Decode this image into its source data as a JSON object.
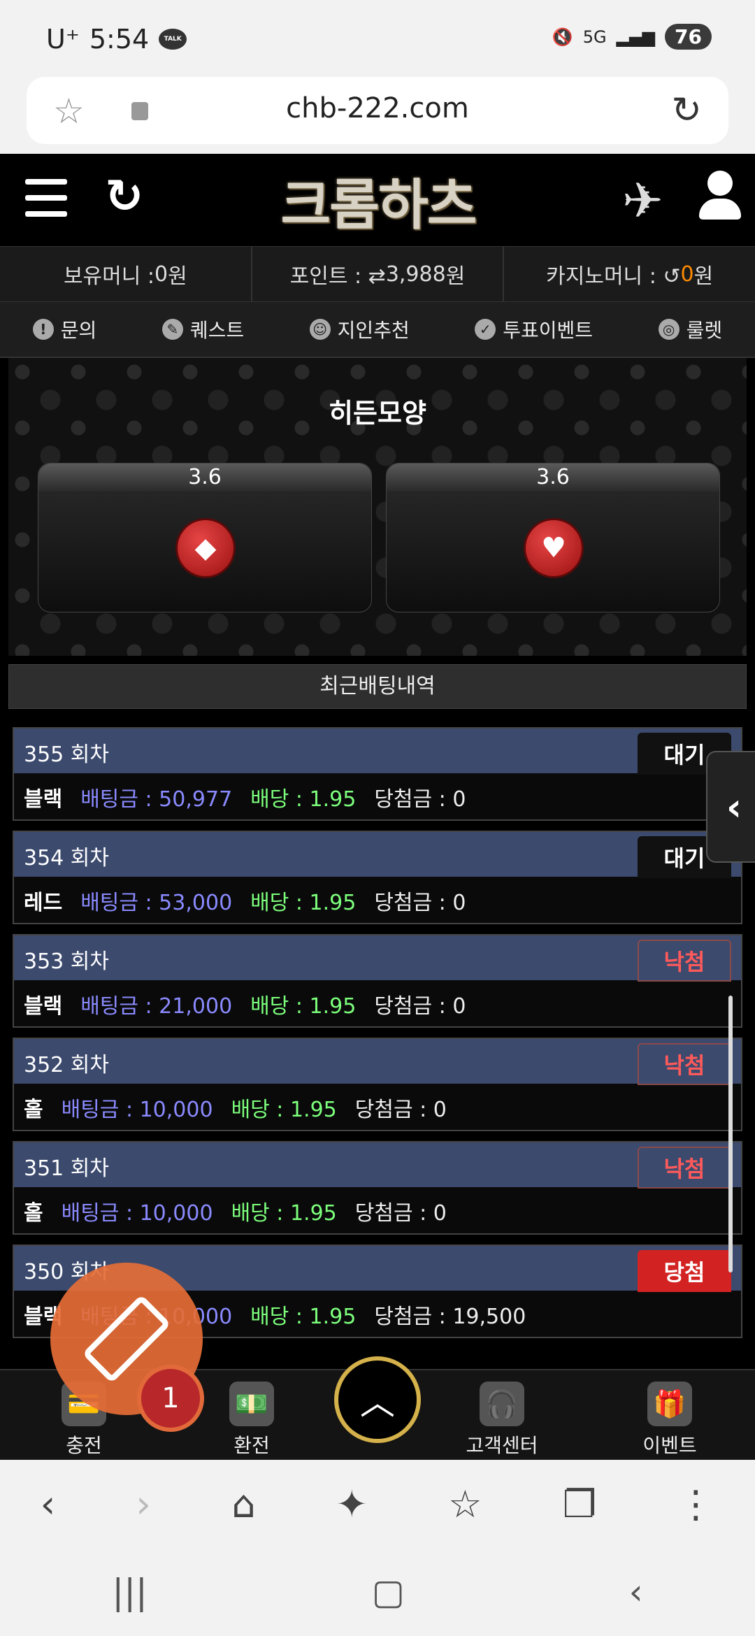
{
  "status": {
    "carrier": "U⁺",
    "time": "5:54",
    "talk": "TALK",
    "battery": "76",
    "signal_text": "5G"
  },
  "browser": {
    "url": "chb-222.com"
  },
  "header": {
    "logo": "크롬하츠"
  },
  "money": {
    "hold_label": "보유머니 : ",
    "hold_value": "0",
    "hold_unit": " 원",
    "point_label": "포인트 : ⇄ ",
    "point_value": "3,988",
    "point_unit": " 원",
    "casino_label": "카지노머니 : ↺ ",
    "casino_value": "0",
    "casino_unit": " 원"
  },
  "menu": {
    "items": [
      {
        "label": "문의",
        "icon": "!"
      },
      {
        "label": "퀘스트",
        "icon": "✎"
      },
      {
        "label": "지인추천",
        "icon": "☺"
      },
      {
        "label": "투표이벤트",
        "icon": "✓"
      },
      {
        "label": "룰렛",
        "icon": "◎"
      }
    ]
  },
  "game": {
    "title": "히든모양",
    "options": [
      {
        "odds": "3.6",
        "symbol": "◆"
      },
      {
        "odds": "3.6",
        "symbol": "♥"
      }
    ]
  },
  "recent": {
    "header": "최근배팅내역",
    "rows": [
      {
        "round": "355 회차",
        "status": "대기",
        "pick": "블랙",
        "amount": "배팅금 : 50,977",
        "odds": "배당 : 1.95",
        "win": "당첨금 : 0"
      },
      {
        "round": "354 회차",
        "status": "대기",
        "pick": "레드",
        "amount": "배팅금 : 53,000",
        "odds": "배당 : 1.95",
        "win": "당첨금 : 0"
      },
      {
        "round": "353 회차",
        "status": "낙첨",
        "pick": "블랙",
        "amount": "배팅금 : 21,000",
        "odds": "배당 : 1.95",
        "win": "당첨금 : 0"
      },
      {
        "round": "352 회차",
        "status": "낙첨",
        "pick": "홀",
        "amount": "배팅금 : 10,000",
        "odds": "배당 : 1.95",
        "win": "당첨금 : 0"
      },
      {
        "round": "351 회차",
        "status": "낙첨",
        "pick": "홀",
        "amount": "배팅금 : 10,000",
        "odds": "배당 : 1.95",
        "win": "당첨금 : 0"
      },
      {
        "round": "350 회차",
        "status": "당첨",
        "pick": "블랙",
        "amount": "배팅금 : 10,000",
        "odds": "배당 : 1.95",
        "win": "당첨금 : 19,500"
      }
    ]
  },
  "bottomnav": {
    "charge": "충전",
    "exchange": "환전",
    "support": "고객센터",
    "event": "이벤트"
  },
  "ticket": {
    "badge": "1"
  }
}
